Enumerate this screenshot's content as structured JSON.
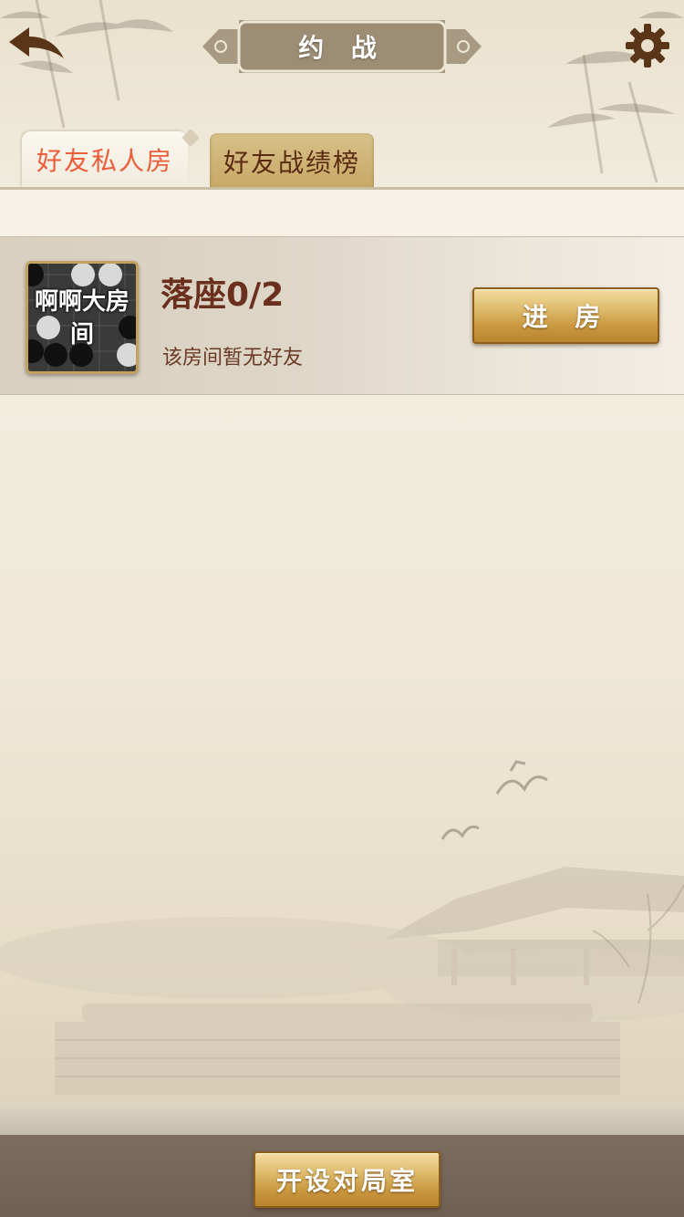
{
  "header": {
    "title": "约 战",
    "back_icon": "back-arrow-icon",
    "settings_icon": "gear-icon"
  },
  "tabs": [
    {
      "label": "好友私人房",
      "active": true
    },
    {
      "label": "好友战绩榜",
      "active": false
    }
  ],
  "rooms": [
    {
      "name": "啊啊大房间",
      "seats": "落座0/2",
      "status": "该房间暂无好友",
      "enter_label": "进 房"
    }
  ],
  "footer": {
    "create_label": "开设对局室"
  },
  "colors": {
    "active_tab_text": "#ec5d3a",
    "room_text": "#6b2f1e",
    "gold_button": "#d4a857",
    "bottom_bar": "#766759"
  }
}
